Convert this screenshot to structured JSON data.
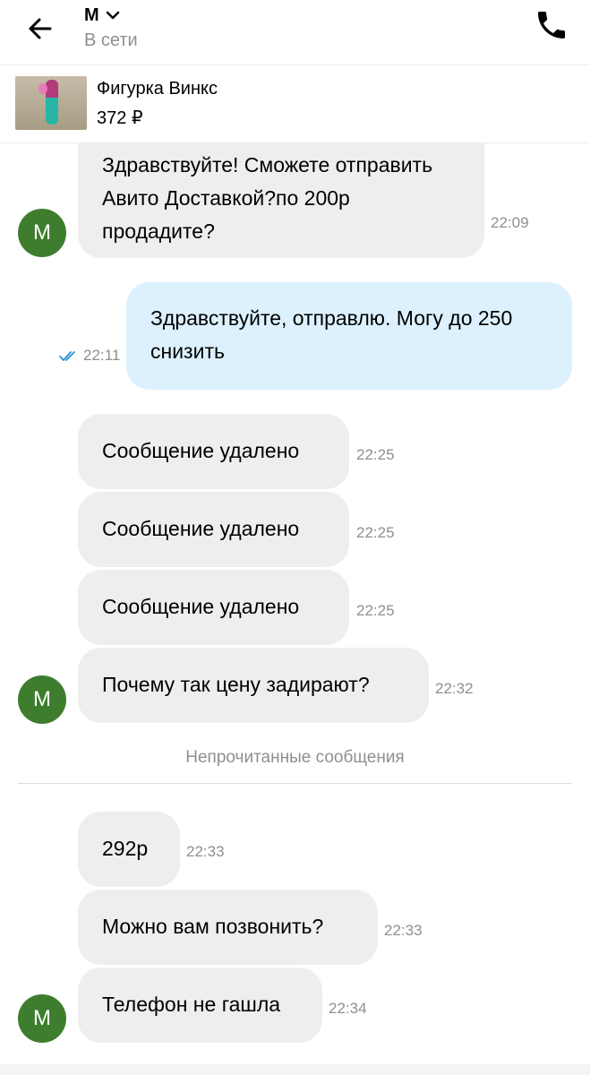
{
  "header": {
    "contact_name": "М",
    "status": "В сети",
    "icons": {
      "back": "arrow-left-icon",
      "dropdown": "chevron-down-icon",
      "call": "phone-icon"
    }
  },
  "listing": {
    "title": "Фигурка Винкс",
    "price": "372 ₽"
  },
  "messages": [
    {
      "direction": "in",
      "text": "Здравствуйте! Сможете отправить Авито Доставкой?по 200р продадите?",
      "time": "22:09",
      "avatar": "М"
    },
    {
      "direction": "out",
      "text": "Здравствуйте, отправлю. Могу до 250 снизить",
      "time": "22:11",
      "read": true
    },
    {
      "direction": "in",
      "text": "Сообщение удалено",
      "time": "22:25"
    },
    {
      "direction": "in",
      "text": "Сообщение удалено",
      "time": "22:25"
    },
    {
      "direction": "in",
      "text": "Сообщение удалено",
      "time": "22:25"
    },
    {
      "direction": "in",
      "text": "Почему так цену задирают?",
      "time": "22:32",
      "avatar": "М"
    },
    {
      "direction": "in",
      "text": "292р",
      "time": "22:33"
    },
    {
      "direction": "in",
      "text": "Можно вам позвонить?",
      "time": "22:33"
    },
    {
      "direction": "in",
      "text": "Телефон не гашла",
      "time": "22:34",
      "avatar": "М"
    }
  ],
  "divider": {
    "text": "Непрочитанные сообщения"
  },
  "colors": {
    "incoming_bubble": "#efeeee",
    "outgoing_bubble": "#dcf1fd",
    "avatar": "#3e7d2e",
    "read_checks": "#2b8fd6"
  }
}
